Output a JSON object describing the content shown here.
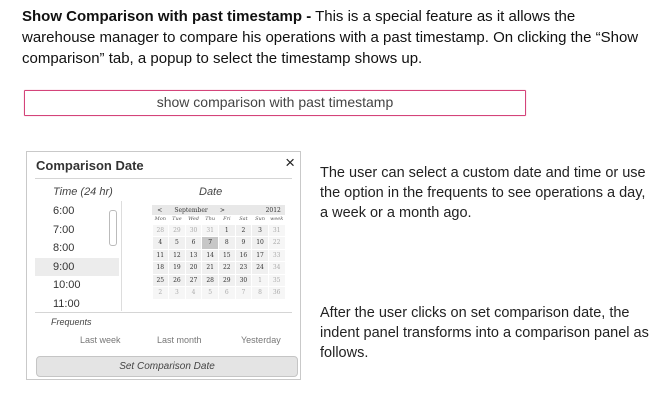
{
  "intro": {
    "heading": "Show Comparison with past timestamp -",
    "body": " This is a special feature as it allows the warehouse manager to compare his operations with a past timestamp. On clicking the “Show comparison” tab, a popup to select the timestamp shows up."
  },
  "comparison_tab": {
    "label": "show comparison with past timestamp"
  },
  "popup": {
    "title": "Comparison Date",
    "close_icon": "×",
    "time_header": "Time (24 hr)",
    "date_header": "Date",
    "times": [
      "6:00",
      "7:00",
      "8:00",
      "9:00",
      "10:00",
      "11:00"
    ],
    "selected_time": "9:00",
    "calendar": {
      "prev": "<",
      "month": "September",
      "next": ">",
      "year": "2012",
      "weekdays": [
        "Mon",
        "Tue",
        "Wed",
        "Thu",
        "Fri",
        "Sat",
        "Sun",
        "week"
      ],
      "rows": [
        [
          "28",
          "29",
          "30",
          "31",
          "1",
          "2",
          "3",
          "31"
        ],
        [
          "4",
          "5",
          "6",
          "7",
          "8",
          "9",
          "10",
          "22"
        ],
        [
          "11",
          "12",
          "13",
          "14",
          "15",
          "16",
          "17",
          "33"
        ],
        [
          "18",
          "19",
          "20",
          "21",
          "22",
          "23",
          "24",
          "34"
        ],
        [
          "25",
          "26",
          "27",
          "28",
          "29",
          "30",
          "1",
          "35"
        ],
        [
          "2",
          "3",
          "4",
          "5",
          "6",
          "7",
          "8",
          "36"
        ]
      ],
      "selected": "7"
    },
    "frequents_label": "Frequents",
    "frequents": [
      "Last week",
      "Last month",
      "Yesterday"
    ],
    "set_button": "Set Comparison Date"
  },
  "side_text": {
    "para1": "The user can select a custom date and time or use the option in the frequents to see operations a day, a week or a month ago.",
    "para2": "After the user clicks on set comparison date, the indent panel transforms into a comparison panel as follows."
  }
}
